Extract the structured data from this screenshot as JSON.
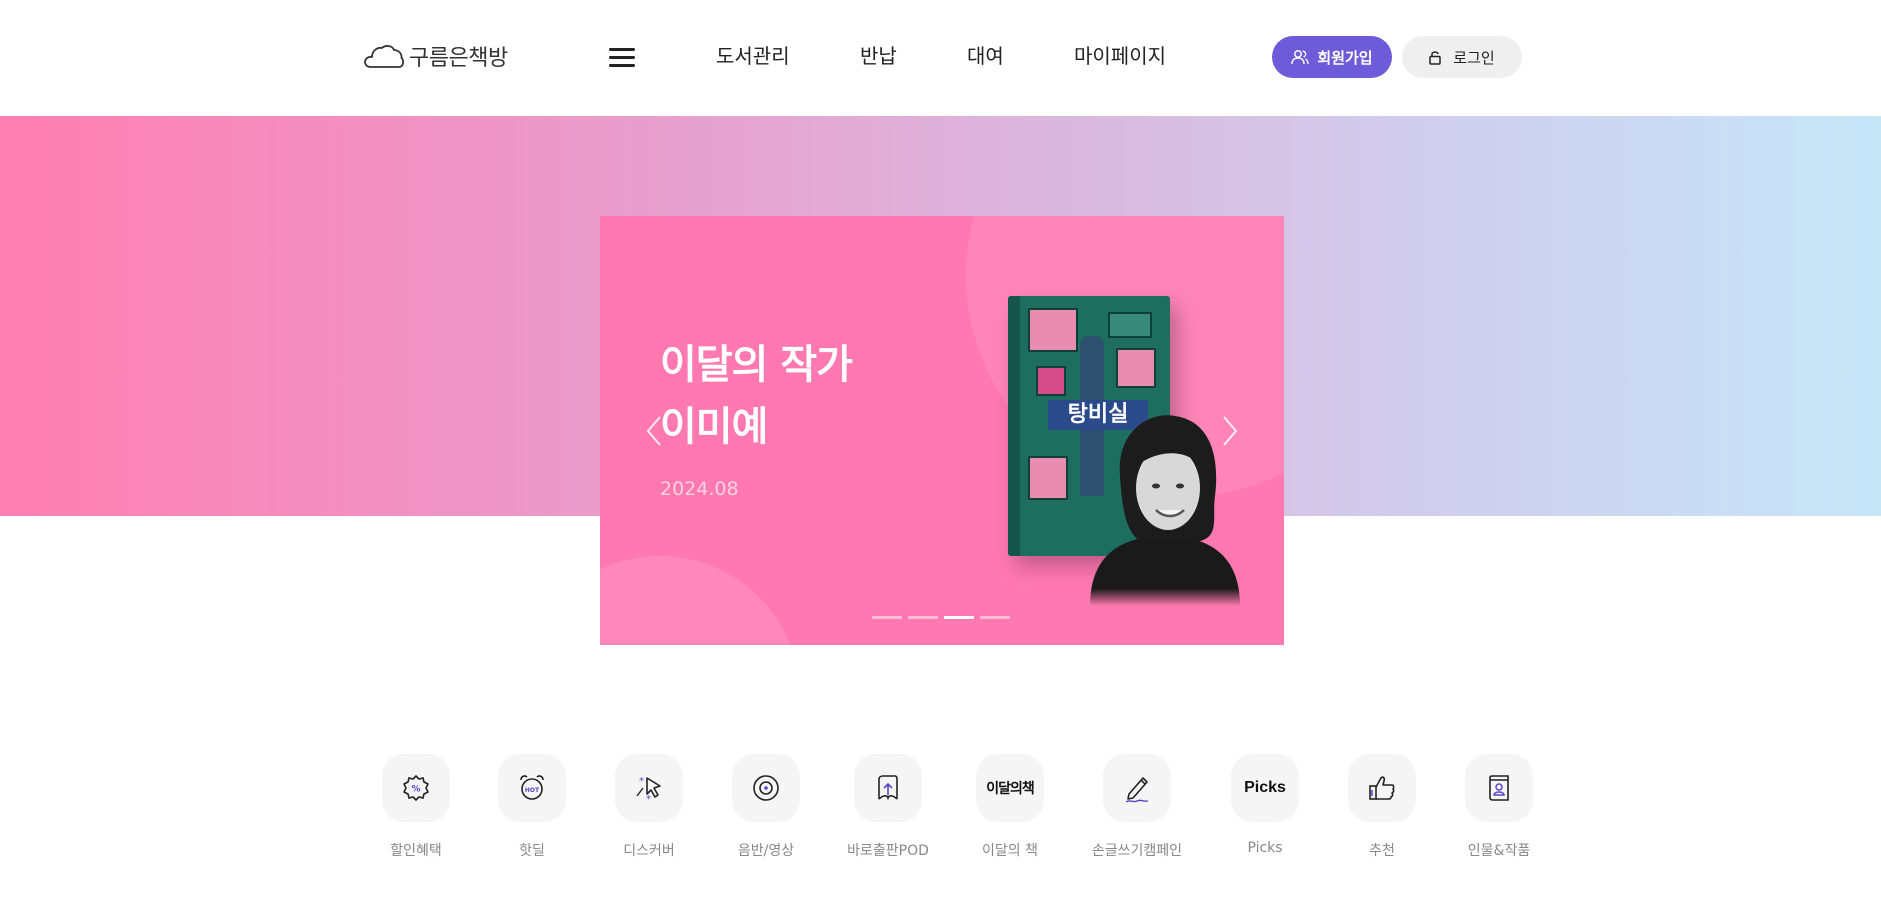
{
  "header": {
    "logo_text": "구름은책방",
    "nav": [
      "도서관리",
      "반납",
      "대여",
      "마이페이지"
    ],
    "signup_label": "회원가입",
    "login_label": "로그인"
  },
  "hero": {
    "title_line1": "이달의 작가",
    "title_line2": "이미예",
    "date": "2024.08",
    "book_title": "탕비실",
    "slide_count": 4,
    "active_slide": 3,
    "colors": {
      "gradient_start": "#ff7fb0",
      "gradient_end": "#c6e6f8",
      "slide_bg": "#ff78b0"
    }
  },
  "categories": [
    {
      "label": "할인혜택",
      "icon": "discount-icon"
    },
    {
      "label": "핫딜",
      "icon": "alarm-clock-hot-icon"
    },
    {
      "label": "디스커버",
      "icon": "cursor-sparkle-icon"
    },
    {
      "label": "음반/영상",
      "icon": "disc-icon"
    },
    {
      "label": "바로출판POD",
      "icon": "upload-book-icon"
    },
    {
      "label": "이달의 책",
      "icon": "month-book-icon",
      "icon_text": "이달의책"
    },
    {
      "label": "손글쓰기캠페인",
      "icon": "pen-icon"
    },
    {
      "label": "Picks",
      "icon": "picks-icon",
      "icon_text": "Picks"
    },
    {
      "label": "추천",
      "icon": "thumbs-up-icon"
    },
    {
      "label": "인물&작품",
      "icon": "person-book-icon"
    }
  ],
  "accent_color": "#6e5bd9"
}
